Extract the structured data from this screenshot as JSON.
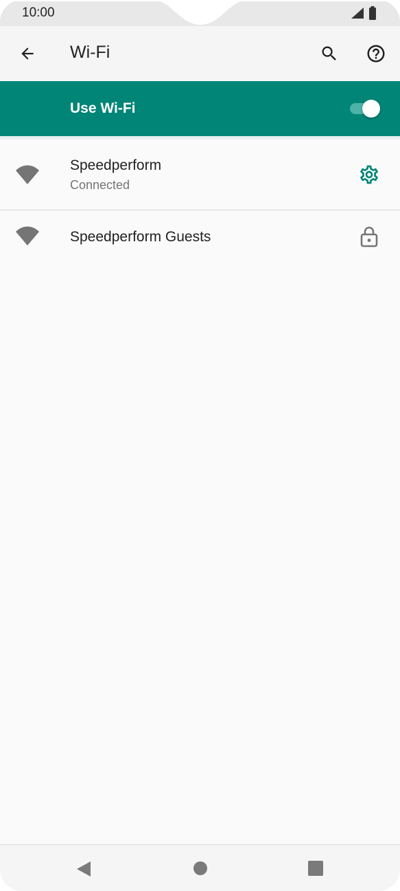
{
  "status_bar": {
    "time": "10:00"
  },
  "toolbar": {
    "title": "Wi-Fi",
    "back_icon": "arrow-back-icon",
    "search_icon": "search-icon",
    "help_icon": "help-icon"
  },
  "wifi_switch": {
    "label": "Use Wi-Fi",
    "enabled": true,
    "color": "#008577"
  },
  "networks": [
    {
      "name": "Speedperform",
      "status": "Connected",
      "icon": "wifi-signal-icon",
      "action_icon": "gear-icon"
    },
    {
      "name": "Speedperform Guests",
      "icon": "wifi-signal-icon",
      "action_icon": "lock-icon"
    }
  ],
  "nav_bar": {
    "back": "nav-back-icon",
    "home": "nav-home-icon",
    "recents": "nav-recents-icon"
  }
}
